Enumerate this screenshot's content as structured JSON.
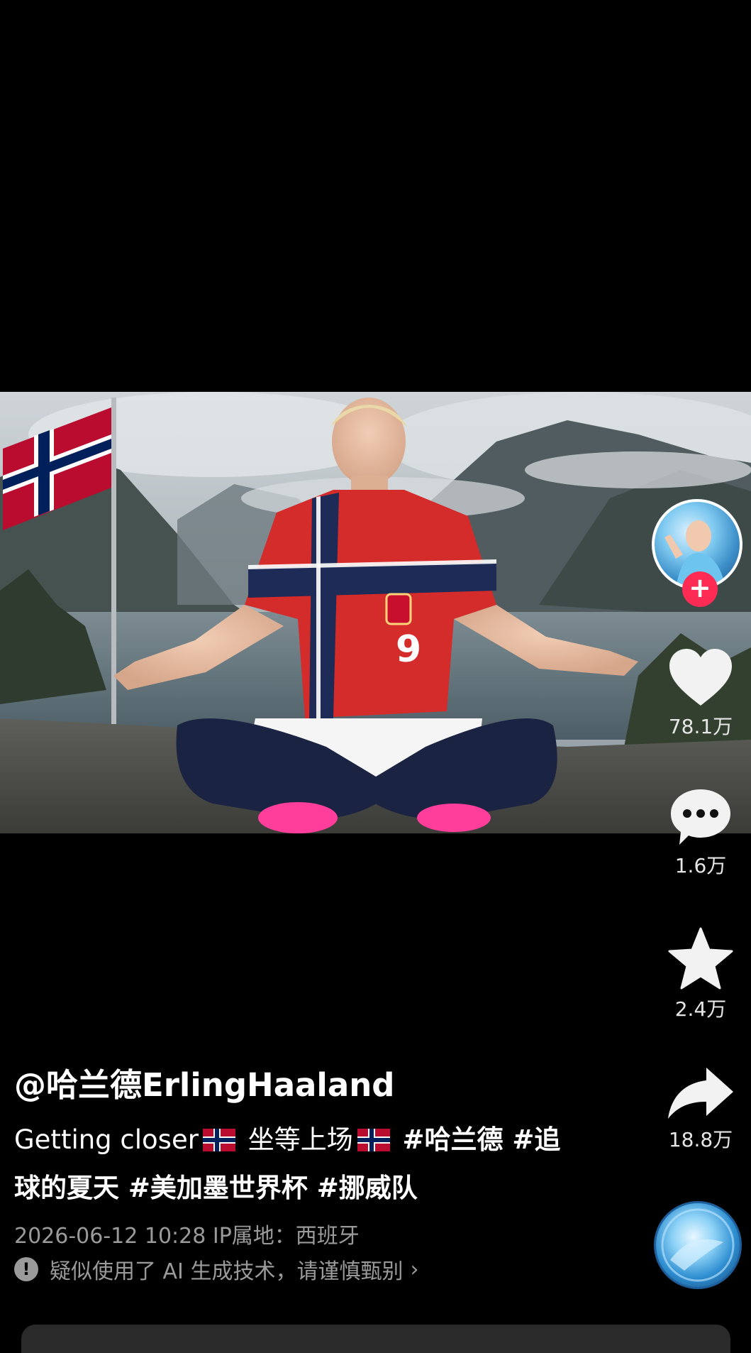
{
  "video": {
    "jersey_number": "9"
  },
  "rail": {
    "likes": "78.1万",
    "comments": "1.6万",
    "favorites": "2.4万",
    "shares": "18.8万",
    "follow_symbol": "+"
  },
  "post": {
    "author": "@哈兰德ErlingHaaland",
    "text_part1": "Getting closer",
    "text_part2": "坐等上场",
    "tags_line1": "#哈兰德 #追",
    "tags_line2": "球的夏天 #美加墨世界杯 #挪威队",
    "meta": "2026-06-12 10:28  IP属地：西班牙",
    "ai_notice": "疑似使用了 AI 生成技术，请谨慎甄别",
    "ai_chevron": "›",
    "ai_warn_symbol": "!"
  },
  "colors": {
    "follow_red": "#fe2c55",
    "norway_red": "#ba0c2f",
    "norway_blue": "#00205b"
  }
}
